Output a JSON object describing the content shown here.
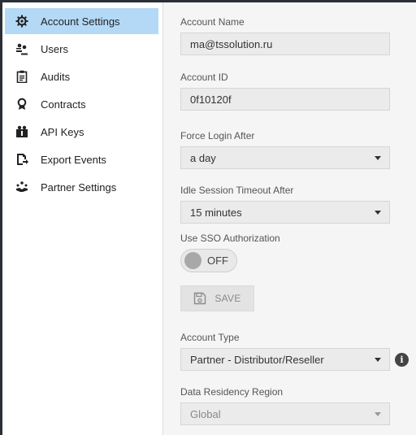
{
  "sidebar": {
    "items": [
      {
        "label": "Account Settings",
        "icon": "gear-icon",
        "active": true
      },
      {
        "label": "Users",
        "icon": "users-icon"
      },
      {
        "label": "Audits",
        "icon": "clipboard-icon"
      },
      {
        "label": "Contracts",
        "icon": "award-icon"
      },
      {
        "label": "API Keys",
        "icon": "key-icon"
      },
      {
        "label": "Export Events",
        "icon": "export-icon"
      },
      {
        "label": "Partner Settings",
        "icon": "partner-icon"
      }
    ]
  },
  "form": {
    "account_name": {
      "label": "Account Name",
      "value": "ma@tssolution.ru"
    },
    "account_id": {
      "label": "Account ID",
      "value": "0f10120f"
    },
    "force_login": {
      "label": "Force Login After",
      "value": "a day"
    },
    "idle_timeout": {
      "label": "Idle Session Timeout After",
      "value": "15 minutes"
    },
    "sso": {
      "label": "Use SSO Authorization",
      "state": "OFF"
    },
    "save_label": "SAVE",
    "account_type": {
      "label": "Account Type",
      "value": "Partner - Distributor/Reseller"
    },
    "data_residency": {
      "label": "Data Residency Region",
      "value": "Global"
    }
  },
  "colors": {
    "active_nav": "#b3d9f7",
    "content_bg": "#f5f5f5",
    "field_bg": "#ebebeb"
  }
}
